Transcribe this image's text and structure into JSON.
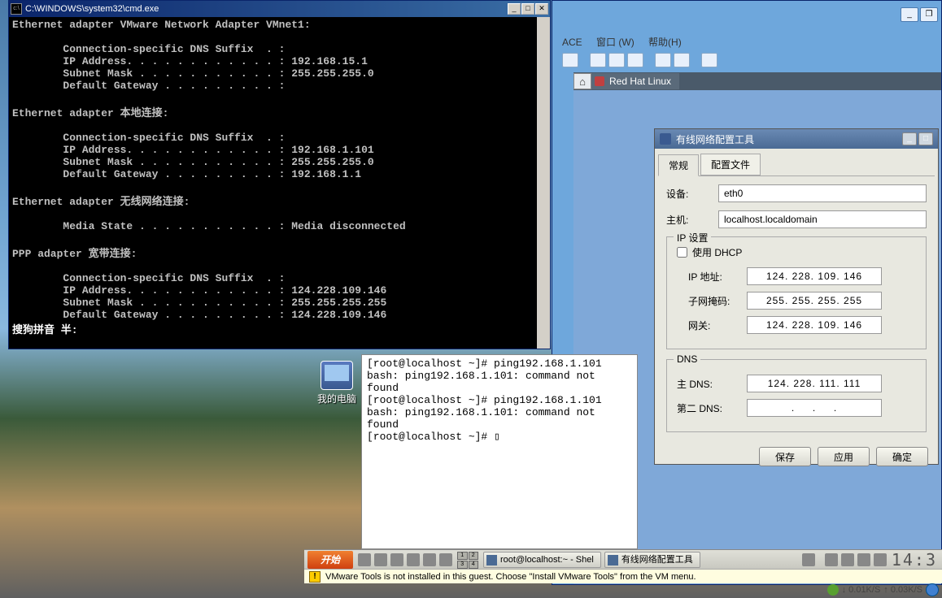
{
  "cmd": {
    "title": "C:\\WINDOWS\\system32\\cmd.exe",
    "body": "Ethernet adapter VMware Network Adapter VMnet1:\n\n        Connection-specific DNS Suffix  . :\n        IP Address. . . . . . . . . . . . : 192.168.15.1\n        Subnet Mask . . . . . . . . . . . : 255.255.255.0\n        Default Gateway . . . . . . . . . :\n\nEthernet adapter 本地连接:\n\n        Connection-specific DNS Suffix  . :\n        IP Address. . . . . . . . . . . . : 192.168.1.101\n        Subnet Mask . . . . . . . . . . . : 255.255.255.0\n        Default Gateway . . . . . . . . . : 192.168.1.1\n\nEthernet adapter 无线网络连接:\n\n        Media State . . . . . . . . . . . : Media disconnected\n\nPPP adapter 宽带连接:\n\n        Connection-specific DNS Suffix  . :\n        IP Address. . . . . . . . . . . . : 124.228.109.146\n        Subnet Mask . . . . . . . . . . . : 255.255.255.255\n        Default Gateway . . . . . . . . . : 124.228.109.146",
    "ime": "搜狗拼音 半:"
  },
  "vmware": {
    "menus": {
      "ace": "ACE",
      "window": "窗口 (W)",
      "help": "帮助(H)"
    },
    "tab_home_glyph": "⌂",
    "tab_label": "Red Hat Linux",
    "status": "VMware Tools is not installed in this guest. Choose \"Install VMware Tools\" from the VM menu."
  },
  "desktop": {
    "mycomputer": "我的电脑"
  },
  "linux_term": {
    "body": "[root@localhost ~]# ping192.168.1.101\nbash: ping192.168.1.101: command not found\n[root@localhost ~]# ping192.168.1.101\nbash: ping192.168.1.101: command not found\n[root@localhost ~]# ▯"
  },
  "net_dialog": {
    "title": "有线网络配置工具",
    "tabs": {
      "general": "常规",
      "profiles": "配置文件"
    },
    "labels": {
      "device": "设备:",
      "host": "主机:",
      "ip_settings": "IP 设置",
      "use_dhcp": "使用 DHCP",
      "ip": "IP 地址:",
      "mask": "子网掩码:",
      "gateway": "网关:",
      "dns_group": "DNS",
      "dns1": "主 DNS:",
      "dns2": "第二 DNS:"
    },
    "values": {
      "device": "eth0",
      "host": "localhost.localdomain",
      "ip": "124. 228. 109. 146",
      "mask": "255. 255. 255. 255",
      "gateway": "124. 228. 109. 146",
      "dns1": "124. 228. 111. 111",
      "dns2": ".     .     ."
    },
    "buttons": {
      "save": "保存",
      "apply": "应用",
      "ok": "确定"
    }
  },
  "gnome": {
    "start": "开始",
    "task1": "root@localhost:~ - Shel",
    "task2": "有线网络配置工具",
    "clock": "14:3"
  },
  "host_tray": {
    "down": "↓ 0.01K/S",
    "up": "↑ 0.03K/S"
  }
}
